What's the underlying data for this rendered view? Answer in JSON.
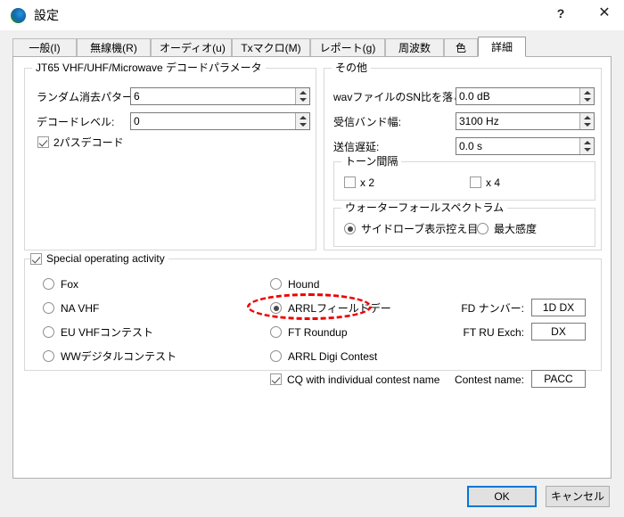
{
  "window": {
    "title": "設定",
    "icon": "globe-icon",
    "help_label": "?",
    "close_label": "✕"
  },
  "tabs": [
    {
      "label": "一般(I)",
      "active": false
    },
    {
      "label": "無線機(R)",
      "active": false
    },
    {
      "label": "オーディオ(u)",
      "active": false
    },
    {
      "label": "Txマクロ(M)",
      "active": false
    },
    {
      "label": "レポート(g)",
      "active": false
    },
    {
      "label": "周波数",
      "active": false
    },
    {
      "label": "色",
      "active": false
    },
    {
      "label": "詳細",
      "active": true
    }
  ],
  "decode_group": {
    "legend": "JT65 VHF/UHF/Microwave デコードパラメータ",
    "random_erasure_label": "ランダム消去パターン:",
    "random_erasure_value": "6",
    "decode_level_label": "デコードレベル:",
    "decode_level_value": "0",
    "two_pass_label": "2パスデコード",
    "two_pass_checked": true
  },
  "other_group": {
    "legend": "その他",
    "wav_sn_label": "wavファイルのSN比を落とす:",
    "wav_sn_value": "0.0 dB",
    "rx_bandwidth_label": "受信バンド幅:",
    "rx_bandwidth_value": "3100  Hz",
    "tx_delay_label": "送信遅延:",
    "tx_delay_value": "0.0  s"
  },
  "tone_group": {
    "legend": "トーン間隔",
    "x2_label": "x 2",
    "x2_checked": false,
    "x4_label": "x 4",
    "x4_checked": false
  },
  "waterfall_group": {
    "legend": "ウォーターフォールスペクトラム",
    "options": [
      {
        "label": "サイドローブ表示控え目",
        "selected": true
      },
      {
        "label": "最大感度",
        "selected": false
      }
    ]
  },
  "special_group": {
    "legend": "Special operating activity",
    "legend_checked": true,
    "left_options": [
      {
        "label": "Fox",
        "selected": false
      },
      {
        "label": "NA VHF",
        "selected": false
      },
      {
        "label": "EU VHFコンテスト",
        "selected": false
      },
      {
        "label": "WWデジタルコンテスト",
        "selected": false
      }
    ],
    "right_options": [
      {
        "label": "Hound",
        "selected": false
      },
      {
        "label": "ARRLフィールドデー",
        "selected": true
      },
      {
        "label": "FT Roundup",
        "selected": false
      },
      {
        "label": "ARRL Digi Contest",
        "selected": false
      }
    ],
    "cq_individual_label": "CQ with individual contest name",
    "cq_individual_checked": true,
    "fd_number_label": "FD ナンバー:",
    "fd_number_value": "1D DX",
    "ft_ru_exch_label": "FT RU Exch:",
    "ft_ru_exch_value": "DX",
    "contest_name_label": "Contest name:",
    "contest_name_value": "PACC"
  },
  "annotation": {
    "shape": "dashed-ellipse",
    "color": "#ee0000",
    "target": "ARRLフィールドデー"
  },
  "footer": {
    "ok_label": "OK",
    "cancel_label": "キャンセル"
  }
}
